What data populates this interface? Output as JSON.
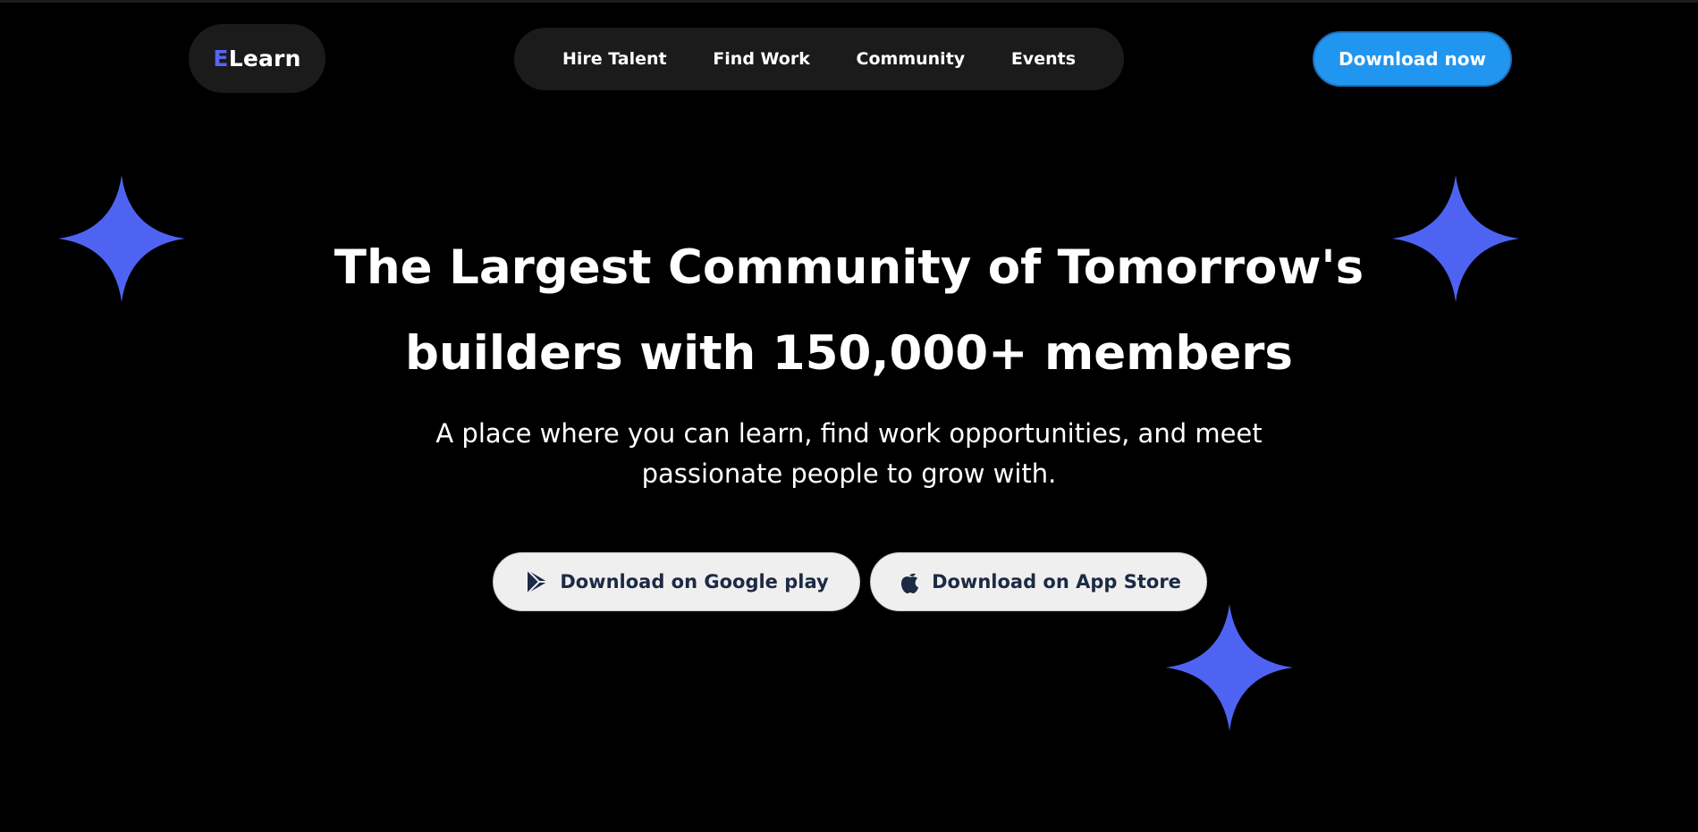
{
  "header": {
    "logo": {
      "accent": "E",
      "rest": "Learn"
    },
    "nav": [
      {
        "label": "Hire Talent"
      },
      {
        "label": "Find Work"
      },
      {
        "label": "Community"
      },
      {
        "label": "Events"
      }
    ],
    "cta_label": "Download now"
  },
  "hero": {
    "title_line1": "The Largest Community of Tomorrow's",
    "title_line2": "builders with 150,000+ members",
    "subtitle_line1": "A place where you can learn, find work opportunities, and meet",
    "subtitle_line2": "passionate people to grow with."
  },
  "stores": {
    "google_label": "Download on Google play",
    "google_icon": "google-play-icon",
    "apple_label": "Download on App Store",
    "apple_icon": "apple-icon"
  },
  "colors": {
    "background": "#000000",
    "pill": "#1b1b1b",
    "accent": "#5a63f5",
    "cta": "#2196f0",
    "store_button": "#efefef",
    "store_text": "#1c2a44",
    "star": "#4f63f3"
  }
}
